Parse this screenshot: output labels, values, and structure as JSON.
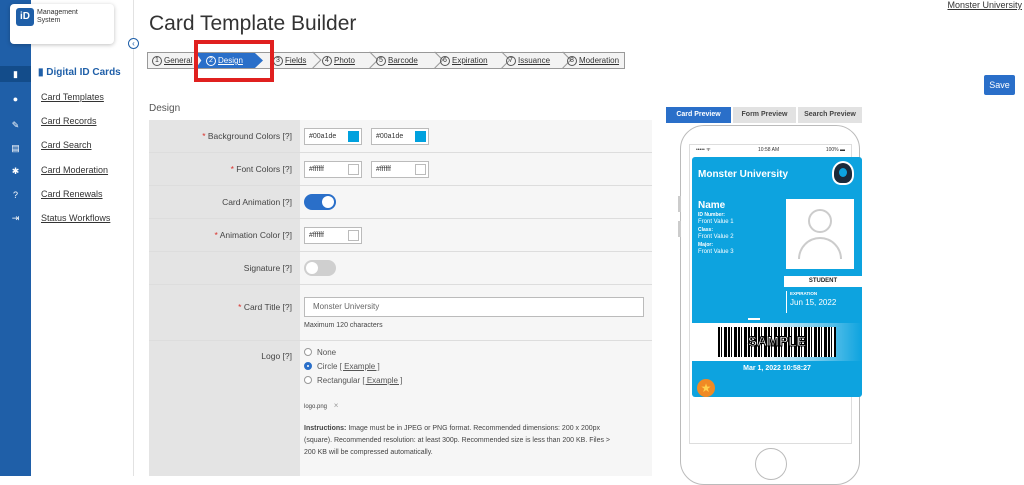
{
  "app": {
    "logo_letters": "iD",
    "logo_line1": "Management",
    "logo_line2": "System",
    "account_link": "Monster University"
  },
  "sidebar": {
    "heading": "Digital ID Cards",
    "items": [
      {
        "label": "Card Templates"
      },
      {
        "label": "Card Records"
      },
      {
        "label": "Card Search"
      },
      {
        "label": "Card Moderation"
      },
      {
        "label": "Card Renewals"
      },
      {
        "label": "Status Workflows"
      }
    ]
  },
  "page": {
    "title": "Card Template Builder",
    "save_label": "Save",
    "section_heading": "Design"
  },
  "wizard": {
    "steps": [
      {
        "num": "1",
        "label": "General"
      },
      {
        "num": "2",
        "label": "Design"
      },
      {
        "num": "3",
        "label": "Fields"
      },
      {
        "num": "4",
        "label": "Photo"
      },
      {
        "num": "5",
        "label": "Barcode"
      },
      {
        "num": "6",
        "label": "Expiration"
      },
      {
        "num": "7",
        "label": "Issuance"
      },
      {
        "num": "8",
        "label": "Moderation"
      }
    ],
    "current": "Design"
  },
  "form": {
    "background_colors": {
      "label": "Background Colors [?]",
      "value1": "#00a1de",
      "value2": "#00a1de"
    },
    "font_colors": {
      "label": "Font Colors [?]",
      "value1": "#ffffff",
      "value2": "#ffffff"
    },
    "card_animation": {
      "label": "Card Animation [?]",
      "on": true
    },
    "animation_color": {
      "label": "Animation Color [?]",
      "value": "#ffffff"
    },
    "signature": {
      "label": "Signature [?]",
      "on": false
    },
    "card_title": {
      "label": "Card Title [?]",
      "value": "Monster University",
      "hint": "Maximum 120 characters"
    },
    "logo": {
      "label": "Logo [?]",
      "options": [
        "None",
        "Circle",
        "Rectangular"
      ],
      "selected": "Circle",
      "example_label": "[ Example ]",
      "file": "logo.png",
      "remove_icon": "×",
      "instructions_bold": "Instructions:",
      "instructions_line1": " Image must be in JPEG or PNG format. Recommended dimensions: 200 x 200px",
      "instructions_line2": "(square). Recommended resolution: at least 300p. Recommended size is less than 200 KB. Files >",
      "instructions_line3": "200 KB will be compressed automatically."
    }
  },
  "preview": {
    "tabs": [
      "Card Preview",
      "Form Preview",
      "Search Preview"
    ],
    "active_tab": "Card Preview",
    "status_left": "••••• ᯤ",
    "status_time": "10:58 AM",
    "status_battery": "100% ▬",
    "card": {
      "title": "Monster University",
      "name": "Name",
      "lines": [
        {
          "head": "ID Number:",
          "value": "Front Value 1"
        },
        {
          "head": "Class:",
          "value": "Front Value 2"
        },
        {
          "head": "Major:",
          "value": "Front Value 3"
        }
      ],
      "status": "STUDENT",
      "expiration_label": "EXPIRATION",
      "expiration_date": "Jun 15, 2022",
      "barcode_text": "SAMPLE",
      "timestamp": "Mar 1, 2022   10:58:27"
    }
  },
  "colors": {
    "accent": "#2a6fc9",
    "sidebar_bg": "#1f5fa8",
    "card_bg": "#0da3df",
    "highlight": "#e0201f"
  }
}
